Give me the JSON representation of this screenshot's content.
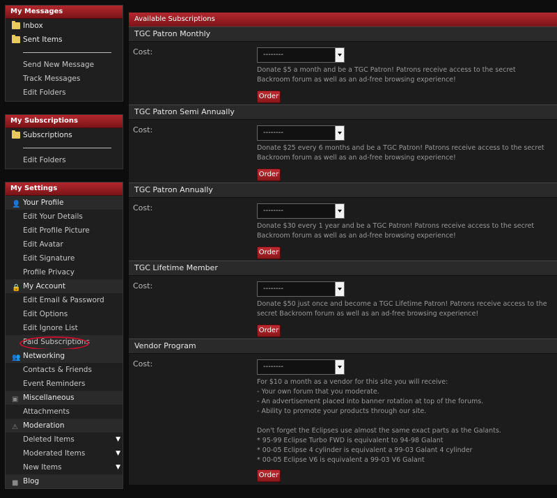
{
  "sidebar": {
    "messages": {
      "title": "My Messages",
      "folders": [
        "Inbox",
        "Sent Items"
      ],
      "links": [
        "Send New Message",
        "Track Messages",
        "Edit Folders"
      ]
    },
    "subscriptions": {
      "title": "My Subscriptions",
      "folders": [
        "Subscriptions"
      ],
      "links": [
        "Edit Folders"
      ]
    },
    "settings": {
      "title": "My Settings",
      "profile": "Your Profile",
      "profile_links": [
        "Edit Your Details",
        "Edit Profile Picture",
        "Edit Avatar",
        "Edit Signature",
        "Profile Privacy"
      ],
      "account": "My Account",
      "account_links": [
        "Edit Email & Password",
        "Edit Options",
        "Edit Ignore List",
        "Paid Subscriptions"
      ],
      "networking": "Networking",
      "networking_links": [
        "Contacts & Friends",
        "Event Reminders"
      ],
      "misc": "Miscellaneous",
      "misc_links": [
        "Attachments"
      ],
      "moderation": "Moderation",
      "moderation_links": [
        "Deleted Items",
        "Moderated Items",
        "New Items"
      ],
      "blog": "Blog"
    }
  },
  "main": {
    "header": "Available Subscriptions",
    "cost_label": "Cost:",
    "select_placeholder": "--------",
    "order_label": "Order",
    "plans": [
      {
        "name": "TGC Patron Monthly",
        "desc": "Donate $5 a month and be a TGC Patron! Patrons receive access to the secret Backroom forum as well as an ad-free browsing experience!"
      },
      {
        "name": "TGC Patron Semi Annually",
        "desc": "Donate $25 every 6 months and be a TGC Patron! Patrons receive access to the secret Backroom forum as well as an ad-free browsing experience!"
      },
      {
        "name": "TGC Patron Annually",
        "desc": "Donate $30 every 1 year and be a TGC Patron! Patrons receive access to the secret Backroom forum as well as an ad-free browsing experience!"
      },
      {
        "name": "TGC Lifetime Member",
        "desc": "Donate $50 just once and become a TGC Lifetime Patron! Patrons receive access to the secret Backroom forum as well as an ad-free browsing experience!"
      },
      {
        "name": "Vendor Program",
        "desc_lines": [
          "For $10 a month as a vendor for this site you will receive:",
          "- Your own forum that you moderate.",
          "- An advertisement placed into banner rotation at top of the forums.",
          "- Ability to promote your products through our site.",
          "",
          "Don't forget the Eclipses use almost the same exact parts as the Galants.",
          "* 95-99 Eclipse Turbo FWD is equivalent to 94-98 Galant",
          "* 00-05 Eclipse 4 cylinder is equivalent a 99-03 Galant 4 cylinder",
          "* 00-05 Eclipse V6 is equivalent a 99-03 V6 Galant"
        ]
      }
    ]
  },
  "colors": {
    "accent": "#a11e24",
    "highlight_circle": "#c8102e"
  }
}
